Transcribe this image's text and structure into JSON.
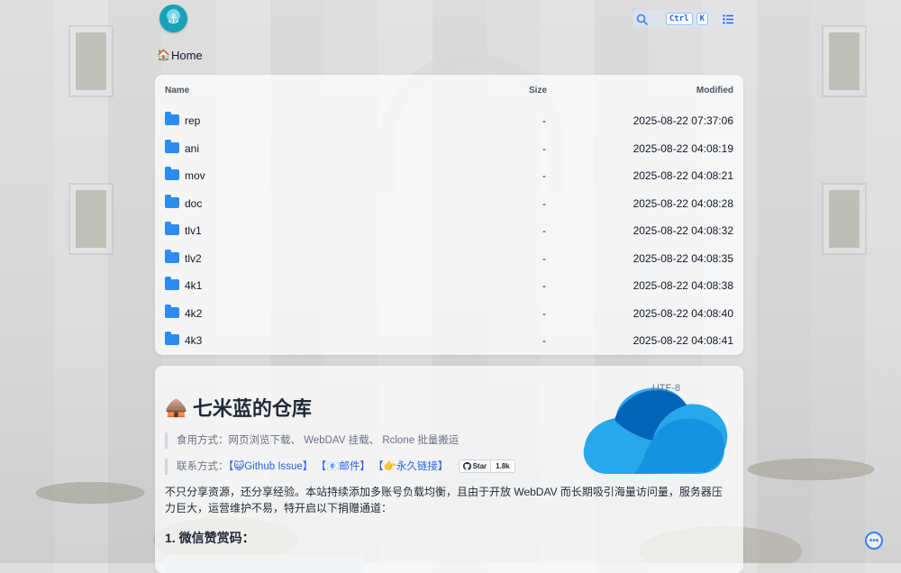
{
  "header": {
    "search_keys": [
      "Ctrl",
      "K"
    ]
  },
  "breadcrumb": {
    "home_icon": "home-icon",
    "home_label": "Home"
  },
  "file_list": {
    "columns": {
      "name": "Name",
      "size": "Size",
      "modified": "Modified"
    },
    "rows": [
      {
        "name": "rep",
        "size": "-",
        "modified": "2025-08-22 07:37:06"
      },
      {
        "name": "ani",
        "size": "-",
        "modified": "2025-08-22 04:08:19"
      },
      {
        "name": "mov",
        "size": "-",
        "modified": "2025-08-22 04:08:21"
      },
      {
        "name": "doc",
        "size": "-",
        "modified": "2025-08-22 04:08:28"
      },
      {
        "name": "tlv1",
        "size": "-",
        "modified": "2025-08-22 04:08:32"
      },
      {
        "name": "tlv2",
        "size": "-",
        "modified": "2025-08-22 04:08:35"
      },
      {
        "name": "4k1",
        "size": "-",
        "modified": "2025-08-22 04:08:38"
      },
      {
        "name": "4k2",
        "size": "-",
        "modified": "2025-08-22 04:08:40"
      },
      {
        "name": "4k3",
        "size": "-",
        "modified": "2025-08-22 04:08:41"
      }
    ]
  },
  "readme": {
    "encoding": "UTF-8",
    "title": "七米蓝的仓库",
    "usage": "食用方式：网页浏览下载、 WebDAV 挂载、 Rclone 批量搬运",
    "contact_label": "联系方式：",
    "contact_links": [
      "【😺Github Issue】",
      "【📧邮件】",
      "【👉永久链接】"
    ],
    "badge_left": "Star",
    "badge_right": "1.8k",
    "paragraph": "不只分享资源，还分享经验。本站持续添加多账号负载均衡，且由于开放 WebDAV 而长期吸引海量访问量，服务器压力巨大，运营维护不易，特开启以下捐赠通道：",
    "section_heading": "1. 微信赞赏码："
  },
  "colors": {
    "accent": "#3b82f6",
    "folder": "#2d8cf0",
    "onedrive_light": "#28a8ea",
    "onedrive_dark": "#0364b8"
  }
}
